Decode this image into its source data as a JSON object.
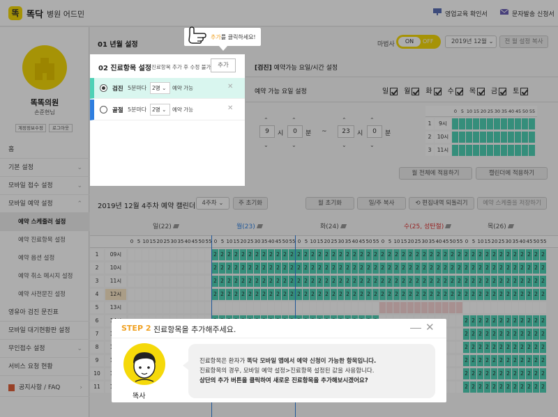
{
  "header": {
    "logo_char": "똑",
    "brand": "똑닥",
    "subtitle": "병원 어드민",
    "links": [
      "영업교육 확인서",
      "문자발송 신청서"
    ]
  },
  "sidebar": {
    "hospital_name": "똑똑의원",
    "manager": "손준현님",
    "buttons": [
      "계정정보수정",
      "로그아웃"
    ],
    "menu": [
      {
        "label": "홈",
        "chevron": ""
      },
      {
        "label": "기본 설정",
        "chevron": "⌄"
      },
      {
        "label": "모바일 접수 설정",
        "chevron": "⌄"
      },
      {
        "label": "모바일 예약 설정",
        "chevron": "⌃"
      }
    ],
    "submenu": [
      "예약 스케줄러 설정",
      "예약 진료항목 설정",
      "예약 옵션 설정",
      "예약 취소 메시지 설정",
      "예약 사전문진 설정"
    ],
    "menu2": [
      {
        "label": "영유아 검진 문진표",
        "chevron": ""
      },
      {
        "label": "모바일 대기현황판 설정",
        "chevron": ""
      },
      {
        "label": "무인접수 설정",
        "chevron": "⌄"
      },
      {
        "label": "서비스 요청 현황",
        "chevron": ""
      }
    ],
    "notice": "공지사항 / FAQ"
  },
  "topbar": {
    "step1": "01 년월 설정",
    "deadline_label": "마법사",
    "toggle_on": "ON",
    "toggle_off": "OFF",
    "month_select": "2019년 12월",
    "copy_all": "전 월 설정 복사"
  },
  "panel": {
    "title": "02 진료항목 설정",
    "note": "진료항목 추가 후 수정 불가",
    "add_button": "추가",
    "tooltip_prefix": "추가",
    "tooltip_suffix": "를 클릭하세요!",
    "items": [
      {
        "name": "검진",
        "interval": "5분마다",
        "count": "2명",
        "status": "예약 가능",
        "selected": true,
        "color": "#4fd1b6"
      },
      {
        "name": "골절",
        "interval": "5분마다",
        "count": "2명",
        "status": "예약 가능",
        "selected": false,
        "color": "#2f7fe0"
      }
    ]
  },
  "time_settings": {
    "title_tag": "[검진]",
    "title_rest": " 예약가능 요일/시간 설정",
    "days_label": "예약 가능 요일 설정",
    "days": [
      "일",
      "월",
      "화",
      "수",
      "목",
      "금",
      "토"
    ],
    "start_hour": "9",
    "start_min": "0",
    "end_hour": "23",
    "end_min": "0",
    "hour_unit": "시",
    "min_unit": "분",
    "tilde": "~",
    "apply_month": "월 전체에 적용하기",
    "apply_calendar": "캘린더에 적용하기",
    "mini_minutes": [
      "0",
      "5",
      "10",
      "15",
      "20",
      "25",
      "30",
      "35",
      "40",
      "45",
      "50",
      "55"
    ],
    "mini_rows": [
      {
        "n": "1",
        "h": "9시"
      },
      {
        "n": "2",
        "h": "10시"
      },
      {
        "n": "3",
        "h": "11시"
      }
    ]
  },
  "calendar": {
    "title": "2019년 12월 4주차 예약 캘린더",
    "week_select": "4주차",
    "reset_week": "주 초기화",
    "reset_month": "월 초기화",
    "copy_week": "일/주 복사",
    "undo": "편집내역 되돌리기",
    "save": "예약 스케줄을 저장하기",
    "days": [
      {
        "label": "일(22)",
        "color": "#555"
      },
      {
        "label": "월(23)",
        "color": "#2f7fe0"
      },
      {
        "label": "화(24)",
        "color": "#555"
      },
      {
        "label": "수(25, 성탄절)",
        "color": "#d33"
      },
      {
        "label": "목(26)",
        "color": "#555"
      }
    ],
    "minutes": [
      "0",
      "5",
      "10",
      "15",
      "20",
      "25",
      "30",
      "35",
      "40",
      "45",
      "50",
      "55"
    ],
    "rows": [
      {
        "n": "1",
        "h": "09시"
      },
      {
        "n": "2",
        "h": "10시"
      },
      {
        "n": "3",
        "h": "11시"
      },
      {
        "n": "4",
        "h": "12시"
      },
      {
        "n": "5",
        "h": "13시"
      },
      {
        "n": "6",
        "h": "14시"
      },
      {
        "n": "7",
        "h": "15시"
      },
      {
        "n": "8",
        "h": "16시"
      },
      {
        "n": "9",
        "h": "17시"
      },
      {
        "n": "10",
        "h": "18시"
      },
      {
        "n": "11",
        "h": "19시"
      }
    ],
    "cell_value": "2"
  },
  "dialog": {
    "step": "STEP 2",
    "title": "진료항목을 추가해주세요.",
    "character": "똑사",
    "line1a": "진료항목은 환자가 ",
    "line1b": "똑닥 모바일 앱에서 예약 신청이 가능한 항목입니다.",
    "line2": "진료항목의 경우, 모바일 예약 설정>진료항목 설정된 값을 사용합니다.",
    "line3": "상단의 추가 버튼을 클릭하여 새로운 진료항목을 추가해보시겠어요?"
  },
  "colors": {
    "accent": "#f5d90a",
    "green": "#4fd1b6",
    "step": "#f0a020",
    "blue": "#2f7fe0"
  }
}
